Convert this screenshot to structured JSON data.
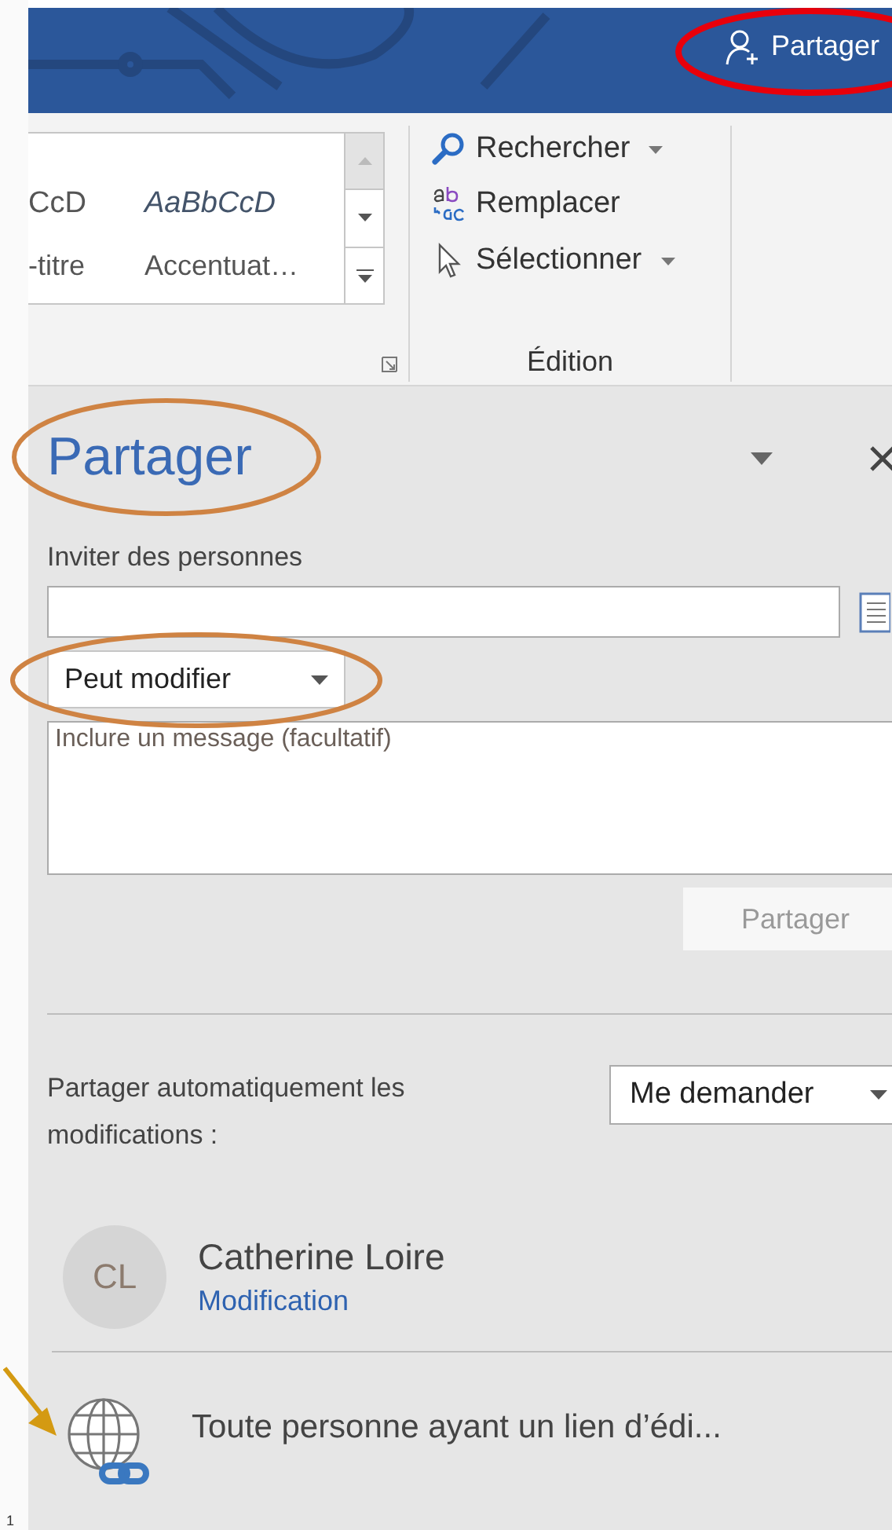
{
  "title_bar": {
    "share_button": "Partager"
  },
  "ribbon": {
    "styles": [
      {
        "sample": "CcD",
        "name": "-titre",
        "italic": false
      },
      {
        "sample": "AaBbCcD",
        "name": "Accentuat…",
        "italic": true
      }
    ],
    "editing": {
      "items": [
        {
          "kind": "search",
          "label": "Rechercher",
          "dropdown": true
        },
        {
          "kind": "replace",
          "label": "Remplacer",
          "dropdown": false
        },
        {
          "kind": "select",
          "label": "Sélectionner",
          "dropdown": true
        }
      ],
      "group_label": "Édition"
    }
  },
  "pane": {
    "title": "Partager",
    "invite_label": "Inviter des personnes",
    "permission": "Peut modifier",
    "message": {
      "placeholder": "Inclure un message (facultatif)"
    },
    "share_button": {
      "label": "Partager",
      "disabled": true
    },
    "auto_share": {
      "label": "Partager automatiquement les modifications :",
      "value": "Me demander"
    },
    "people": [
      {
        "kind": "person",
        "initials": "CL",
        "name": "Catherine Loire",
        "role": "Modification"
      },
      {
        "kind": "link",
        "name": "Toute personne ayant un lien d’édi..."
      }
    ]
  },
  "page_marker": "1"
}
